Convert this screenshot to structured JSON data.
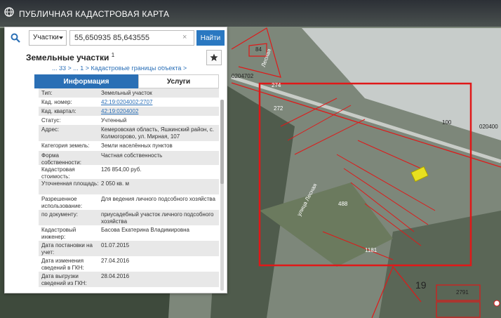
{
  "app": {
    "title": "ПУБЛИЧНАЯ КАДАСТРОВАЯ КАРТА"
  },
  "search": {
    "type_value": "Участки",
    "query": "55,650935 85,643555",
    "clear": "×",
    "find_label": "Найти"
  },
  "card": {
    "title": "Земельные участки",
    "count": "1",
    "breadcrumb": "... 33 >  ... 1 >  Кадастровые границы объекта >"
  },
  "tabs": {
    "info": "Информация",
    "services": "Услуги"
  },
  "rows": [
    {
      "key": "Тип:",
      "value": "Земельный участок"
    },
    {
      "key": "Кад. номер:",
      "value": "42:19:0204002:2707",
      "link": true
    },
    {
      "key": "Кад. квартал:",
      "value": "42:19:0204002",
      "link": true
    },
    {
      "key": "Статус:",
      "value": "Учтенный"
    },
    {
      "key": "Адрес:",
      "value": "Кемеровская область, Яшкинский район, с. Колмогорово, ул. Мирная, 107"
    },
    {
      "key": "Категория земель:",
      "value": "Земли населённых пунктов"
    },
    {
      "key": "Форма собственности:",
      "value": "Частная собственность"
    },
    {
      "key": "Кадастровая стоимость:",
      "value": "126 854,00 руб."
    },
    {
      "key": "Уточненная площадь:",
      "value": "2 050 кв. м"
    },
    {
      "key": "Разрешенное использование:",
      "value": "Для ведения личного подсобного хозяйства"
    },
    {
      "key": "по документу:",
      "value": "приусадебный участок личного подсобного хозяйства"
    },
    {
      "key": "Кадастровый инженер:",
      "value": "Басова Екатерина Владимировна"
    },
    {
      "key": "Дата постановки на учет:",
      "value": "01.07.2015"
    },
    {
      "key": "Дата изменения сведений в ГКН:",
      "value": "27.04.2016"
    },
    {
      "key": "Дата выгрузки сведений из ГКН:",
      "value": "28.04.2016"
    }
  ],
  "map_labels": {
    "lbl84": "84",
    "lbl0204702": "0204702",
    "lbl272": "272",
    "lbl274": "274",
    "lbl100": "100",
    "lbl020400": "020400",
    "lbl1181": "1181",
    "lbl19": "19",
    "lbl2791": "2791",
    "lbl488": "488",
    "road1": "Лесная",
    "road2": "улица Лесная"
  },
  "colors": {
    "accent": "#2a6fb5",
    "cadastre_line": "#e01818",
    "highlight": "#e8e020"
  }
}
